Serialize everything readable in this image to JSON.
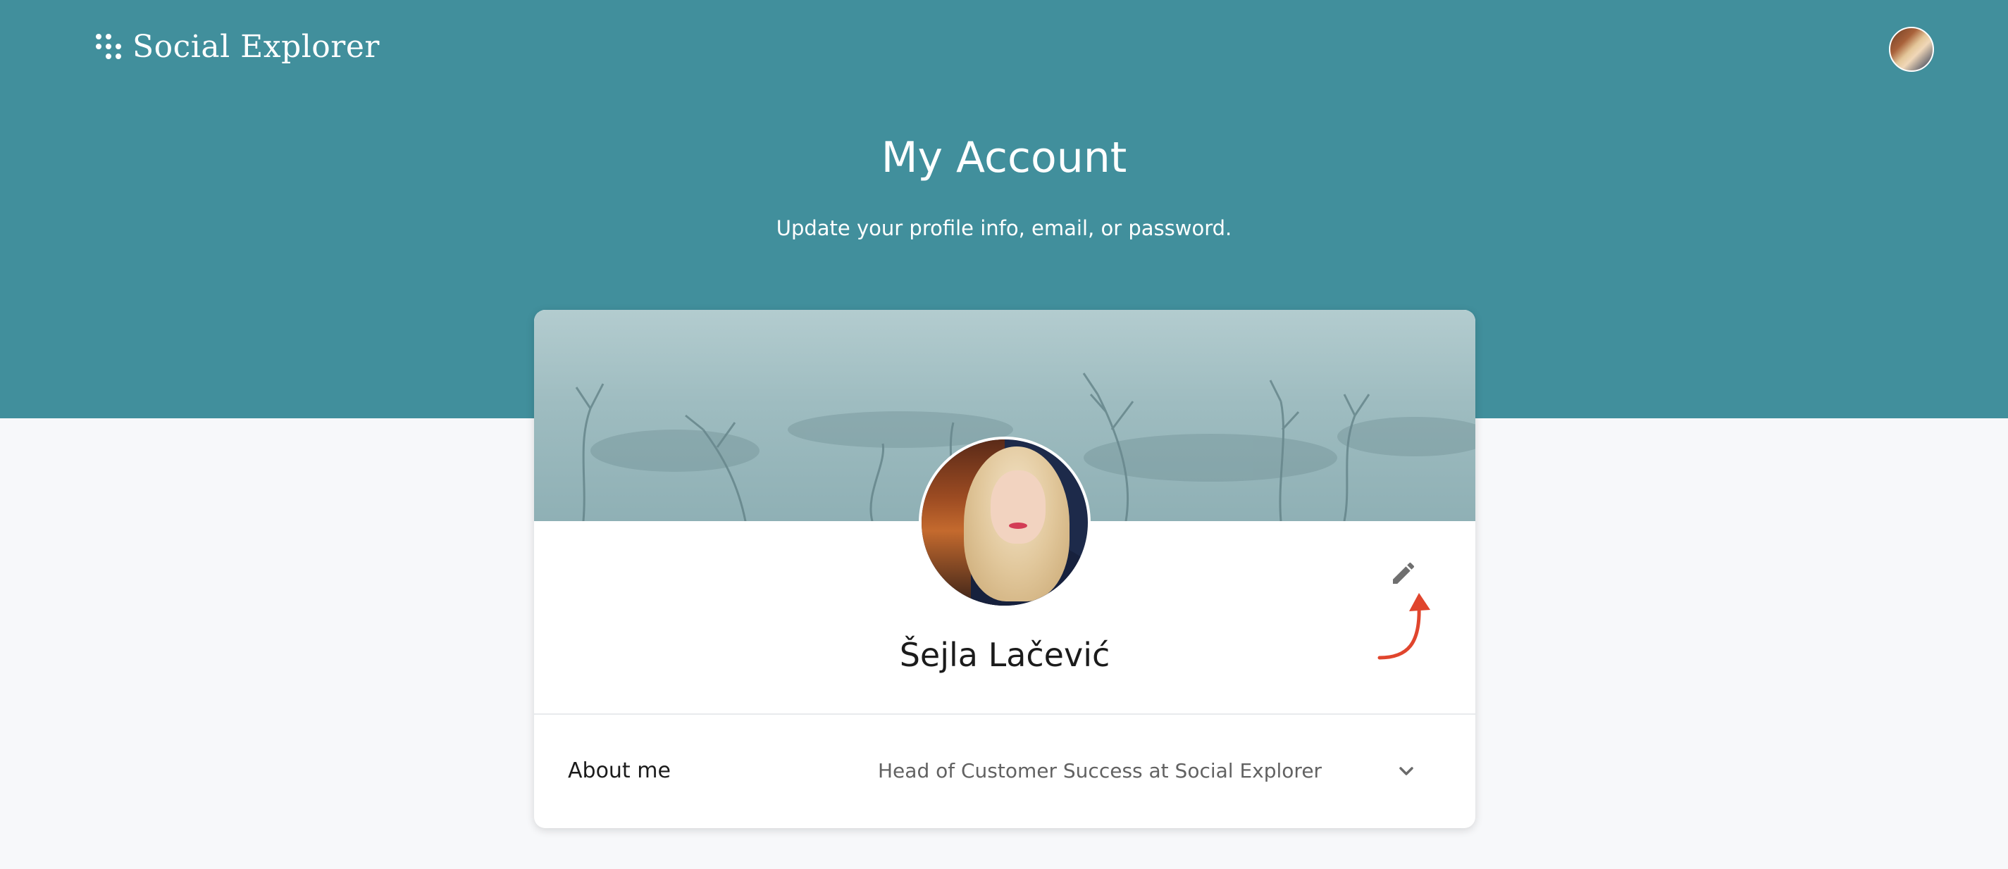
{
  "app": {
    "brand": "Social Explorer",
    "logo_icon": "dots-logo-icon",
    "accent_color": "#418f9c",
    "annotation_color": "#e0452d"
  },
  "header": {
    "user_avatar_icon": "user-avatar"
  },
  "page": {
    "title": "My Account",
    "subtitle": "Update your profile info, email, or password."
  },
  "profile": {
    "name": "Šejla Lačević",
    "edit_icon": "pencil-icon",
    "about_label": "About me",
    "about_value": "Head of Customer Success at Social Explorer",
    "expand_icon": "chevron-down-icon"
  }
}
